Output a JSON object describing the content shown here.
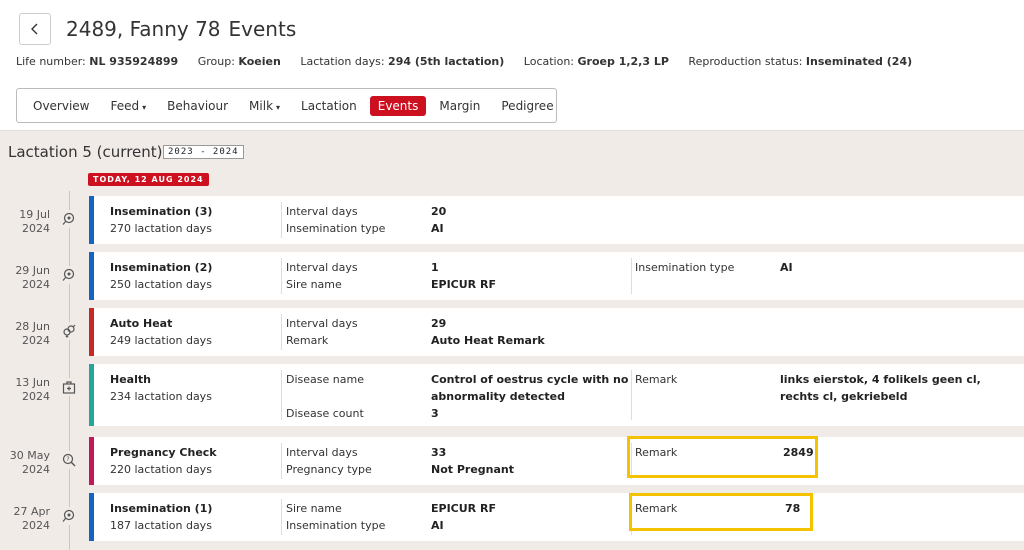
{
  "header": {
    "title": "2489, Fanny 78",
    "subtitle": "Events",
    "info": [
      {
        "label": "Life number:",
        "value": "NL 935924899"
      },
      {
        "label": "Group:",
        "value": "Koeien"
      },
      {
        "label": "Lactation days:",
        "value": "294 (5th lactation)"
      },
      {
        "label": "Location:",
        "value": "Groep 1,2,3 LP"
      },
      {
        "label": "Reproduction status:",
        "value": "Inseminated (24)"
      }
    ]
  },
  "tabs": [
    {
      "label": "Overview"
    },
    {
      "label": "Feed",
      "caret": "▾"
    },
    {
      "label": "Behaviour"
    },
    {
      "label": "Milk",
      "caret": "▾"
    },
    {
      "label": "Lactation"
    },
    {
      "label": "Events"
    },
    {
      "label": "Margin"
    },
    {
      "label": "Pedigree"
    }
  ],
  "lactation": {
    "title": "Lactation 5 (current)",
    "years": "2023 - 2024",
    "today": "TODAY, 12 AUG 2024"
  },
  "colors": {
    "blue": "#1565c0",
    "red": "#c62828",
    "teal": "#26a69a",
    "magenta": "#c2185b",
    "highlight": "#f5c200"
  },
  "events": [
    {
      "date1": "19 Jul",
      "date2": "2024",
      "icon": "insemination-icon",
      "name": "Insemination (3)",
      "days": "270 lactation days",
      "f1l": "Interval days",
      "f1v": "20",
      "f2l": "Insemination type",
      "f2v": "AI",
      "f3l": "",
      "f3v": ""
    },
    {
      "date1": "29 Jun",
      "date2": "2024",
      "icon": "insemination-icon",
      "name": "Insemination (2)",
      "days": "250 lactation days",
      "f1l": "Interval days",
      "f1v": "1",
      "f2l": "Sire name",
      "f2v": "EPICUR RF",
      "f3l": "Insemination type",
      "f3v": "AI"
    },
    {
      "date1": "28 Jun",
      "date2": "2024",
      "icon": "heat-icon",
      "name": "Auto Heat",
      "days": "249 lactation days",
      "f1l": "Interval days",
      "f1v": "29",
      "f2l": "Remark",
      "f2v": "Auto Heat Remark",
      "f3l": "",
      "f3v": ""
    },
    {
      "date1": "13 Jun",
      "date2": "2024",
      "icon": "health-icon",
      "name": "Health",
      "days": "234 lactation days",
      "f1l": "Disease name",
      "f1v": "Control of oestrus cycle with no",
      "f1v2": "abnormality detected",
      "f2l": "Disease count",
      "f2v": "3",
      "f3l": "Remark",
      "f3v": "links eierstok, 4 folikels geen cl,",
      "f3v2": "rechts cl, gekriebeld"
    },
    {
      "date1": "30 May",
      "date2": "2024",
      "icon": "pregnancy-check-icon",
      "name": "Pregnancy Check",
      "days": "220 lactation days",
      "f1l": "Interval days",
      "f1v": "33",
      "f2l": "Pregnancy type",
      "f2v": "Not Pregnant",
      "f3l": "Remark",
      "f3v": "2849"
    },
    {
      "date1": "27 Apr",
      "date2": "2024",
      "icon": "insemination-icon",
      "name": "Insemination (1)",
      "days": "187 lactation days",
      "f1l": "Sire name",
      "f1v": "EPICUR RF",
      "f2l": "Insemination type",
      "f2v": "AI",
      "f3l": "Remark",
      "f3v": "78"
    }
  ]
}
